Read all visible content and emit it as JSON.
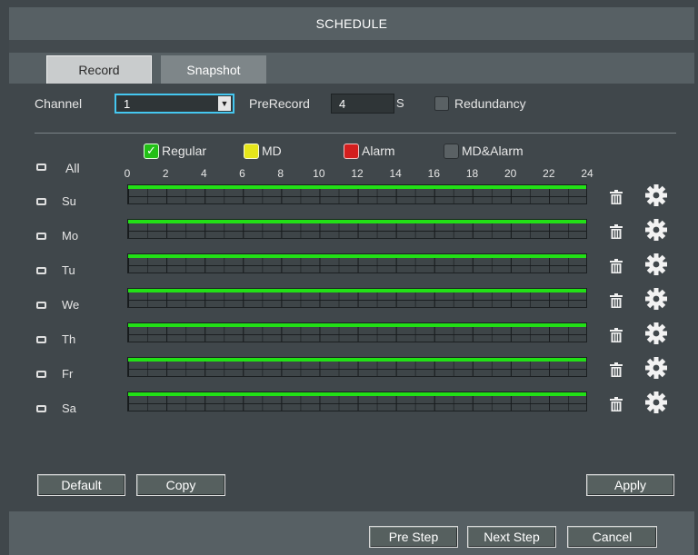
{
  "title": "SCHEDULE",
  "tabs": [
    {
      "label": "Record",
      "active": true
    },
    {
      "label": "Snapshot",
      "active": false
    }
  ],
  "settings": {
    "channel_label": "Channel",
    "channel_value": "1",
    "prerecord_label": "PreRecord",
    "prerecord_value": "4",
    "prerecord_unit": "S",
    "redundancy_label": "Redundancy",
    "redundancy_checked": false
  },
  "legend": [
    {
      "label": "Regular",
      "color": "#22c016",
      "checked": true
    },
    {
      "label": "MD",
      "color": "#e6e61a",
      "checked": false
    },
    {
      "label": "Alarm",
      "color": "#d41e1e",
      "checked": false
    },
    {
      "label": "MD&Alarm",
      "color": "#5a6164",
      "checked": false
    }
  ],
  "all_label": "All",
  "hours": [
    "0",
    "2",
    "4",
    "6",
    "8",
    "10",
    "12",
    "14",
    "16",
    "18",
    "20",
    "22",
    "24"
  ],
  "days": [
    {
      "label": "Su",
      "schedule": [
        [
          0,
          24
        ]
      ]
    },
    {
      "label": "Mo",
      "schedule": [
        [
          0,
          24
        ]
      ]
    },
    {
      "label": "Tu",
      "schedule": [
        [
          0,
          24
        ]
      ]
    },
    {
      "label": "We",
      "schedule": [
        [
          0,
          24
        ]
      ]
    },
    {
      "label": "Th",
      "schedule": [
        [
          0,
          24
        ]
      ]
    },
    {
      "label": "Fr",
      "schedule": [
        [
          0,
          24
        ]
      ]
    },
    {
      "label": "Sa",
      "schedule": [
        [
          0,
          24
        ]
      ]
    }
  ],
  "buttons": {
    "default": "Default",
    "copy": "Copy",
    "apply": "Apply",
    "pre_step": "Pre Step",
    "next_step": "Next Step",
    "cancel": "Cancel"
  },
  "icons": {
    "delete": "trash-icon",
    "settings": "gear-icon"
  }
}
